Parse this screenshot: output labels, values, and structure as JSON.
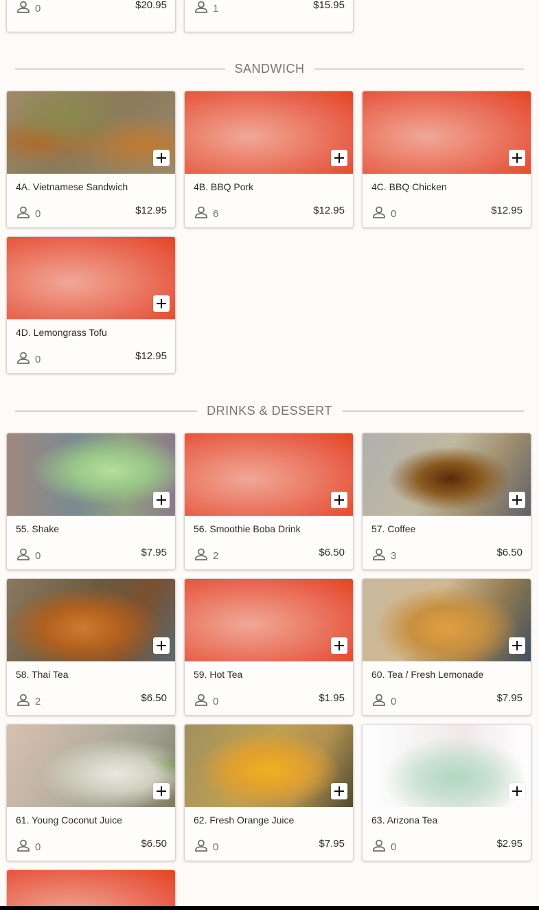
{
  "top_cards": [
    {
      "count": "0",
      "price": "$20.95"
    },
    {
      "count": "1",
      "price": "$15.95"
    }
  ],
  "sandwich": {
    "title": "SANDWICH",
    "items": [
      {
        "name": "4A. Vietnamese Sandwich",
        "count": "0",
        "price": "$12.95"
      },
      {
        "name": "4B. BBQ Pork",
        "count": "6",
        "price": "$12.95"
      },
      {
        "name": "4C. BBQ Chicken",
        "count": "0",
        "price": "$12.95"
      },
      {
        "name": "4D. Lemongrass Tofu",
        "count": "0",
        "price": "$12.95"
      }
    ]
  },
  "drinks": {
    "title": "DRINKS & DESSERT",
    "items": [
      {
        "name": "55. Shake",
        "count": "0",
        "price": "$7.95"
      },
      {
        "name": "56. Smoothie Boba Drink",
        "count": "2",
        "price": "$6.50"
      },
      {
        "name": "57. Coffee",
        "count": "3",
        "price": "$6.50"
      },
      {
        "name": "58. Thai Tea",
        "count": "2",
        "price": "$6.50"
      },
      {
        "name": "59. Hot Tea",
        "count": "0",
        "price": "$1.95"
      },
      {
        "name": "60. Tea / Fresh Lemonade",
        "count": "0",
        "price": "$7.95"
      },
      {
        "name": "61. Young Coconut Juice",
        "count": "0",
        "price": "$6.50"
      },
      {
        "name": "62. Fresh Orange Juice",
        "count": "0",
        "price": "$7.95"
      },
      {
        "name": "63. Arizona Tea",
        "count": "0",
        "price": "$2.95"
      }
    ]
  },
  "icons": {
    "add": "plus-icon",
    "count": "person-icon"
  },
  "colors": {
    "placeholder_photo": "#e8604a",
    "background": "#fdfaf7"
  }
}
